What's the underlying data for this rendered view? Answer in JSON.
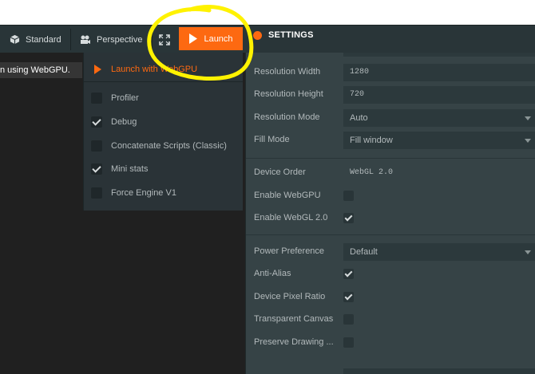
{
  "toolbar": {
    "standard_label": "Standard",
    "perspective_label": "Perspective",
    "launch_label": "Launch"
  },
  "settings": {
    "title": "SETTINGS"
  },
  "viewport": {
    "message": "n using WebGPU."
  },
  "launch_menu": {
    "launch_with": "Launch with WebGPU",
    "items": [
      {
        "label": "Profiler",
        "checked": false
      },
      {
        "label": "Debug",
        "checked": true
      },
      {
        "label": "Concatenate Scripts (Classic)",
        "checked": false
      },
      {
        "label": "Mini stats",
        "checked": true
      },
      {
        "label": "Force Engine V1",
        "checked": false
      }
    ]
  },
  "panel": {
    "resolution_width": {
      "label": "Resolution Width",
      "value": "1280"
    },
    "resolution_height": {
      "label": "Resolution Height",
      "value": "720"
    },
    "resolution_mode": {
      "label": "Resolution Mode",
      "value": "Auto"
    },
    "fill_mode": {
      "label": "Fill Mode",
      "value": "Fill window"
    },
    "device_order": {
      "label": "Device Order",
      "value": "WebGL 2.0"
    },
    "enable_webgpu": {
      "label": "Enable WebGPU",
      "checked": false
    },
    "enable_webgl2": {
      "label": "Enable WebGL 2.0",
      "checked": true
    },
    "power_preference": {
      "label": "Power Preference",
      "value": "Default"
    },
    "anti_alias": {
      "label": "Anti-Alias",
      "checked": true
    },
    "device_pixel_ratio": {
      "label": "Device Pixel Ratio",
      "checked": true
    },
    "transparent_canvas": {
      "label": "Transparent Canvas",
      "checked": false
    },
    "preserve_drawing": {
      "label": "Preserve Drawing ...",
      "checked": false
    }
  },
  "colors": {
    "accent": "#fd6911",
    "annotation": "#fff200"
  }
}
